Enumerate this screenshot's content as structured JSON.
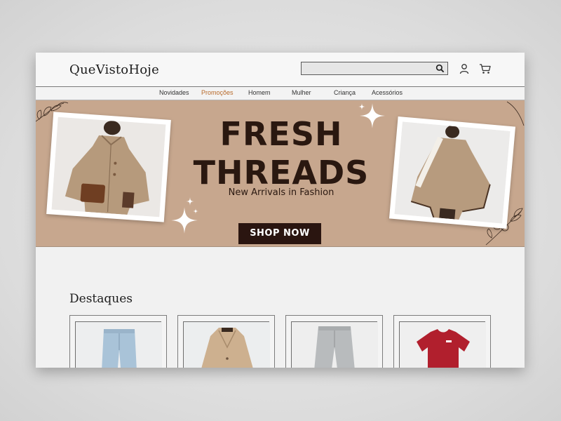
{
  "header": {
    "logo": "QueVistoHoje",
    "search_placeholder": "",
    "icons": [
      "search-icon",
      "user-icon",
      "cart-icon"
    ]
  },
  "nav": {
    "items": [
      {
        "label": "Novidades",
        "active": false
      },
      {
        "label": "Promoções",
        "active": true
      },
      {
        "label": "Homem",
        "active": false
      },
      {
        "label": "Mulher",
        "active": false
      },
      {
        "label": "Criança",
        "active": false
      },
      {
        "label": "Acessórios",
        "active": false
      }
    ],
    "active_color": "#b86a2a"
  },
  "banner": {
    "headline_line1": "FRESH",
    "headline_line2": "THREADS",
    "subheadline": "New Arrivals in Fashion",
    "cta": "SHOP NOW",
    "background_color": "#c7a78e",
    "text_color": "#2a1810"
  },
  "featured": {
    "title": "Destaques",
    "products": [
      {
        "image": "light-blue-jeans"
      },
      {
        "image": "beige-coat"
      },
      {
        "image": "grey-jeans"
      },
      {
        "image": "red-t-shirt"
      }
    ]
  }
}
